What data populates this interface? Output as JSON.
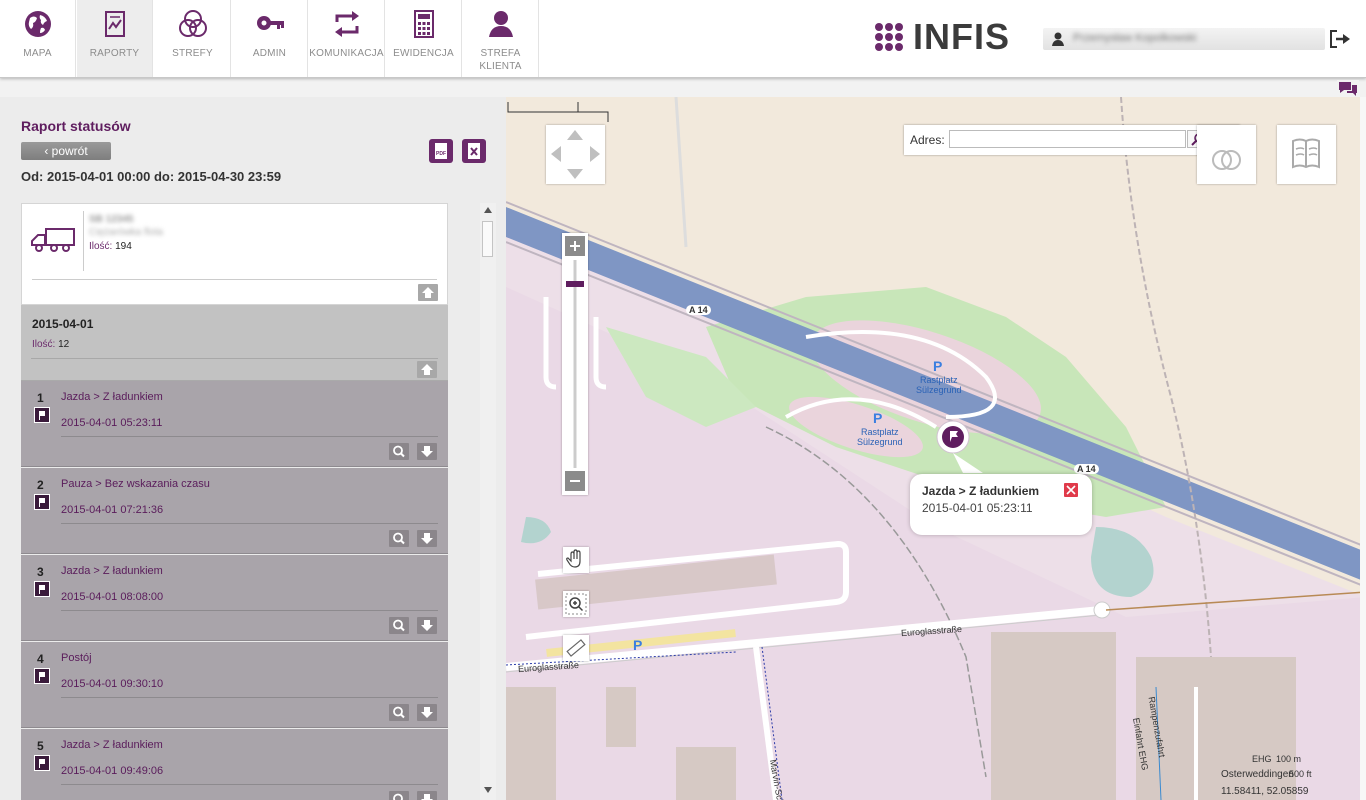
{
  "nav": [
    {
      "label": "MAPA",
      "icon": "globe-icon"
    },
    {
      "label": "RAPORTY",
      "icon": "report-chart-icon",
      "active": true
    },
    {
      "label": "STREFY",
      "icon": "zones-circles-icon"
    },
    {
      "label": "ADMIN",
      "icon": "key-icon"
    },
    {
      "label": "KOMUNIKACJA",
      "icon": "sync-arrows-icon"
    },
    {
      "label": "EWIDENCJA",
      "icon": "calculator-icon"
    },
    {
      "label": "STREFA",
      "label2": "KLIENTA",
      "icon": "user-icon"
    }
  ],
  "brand": {
    "logo_text": "INFIS",
    "accent_color": "#5f1d5f"
  },
  "user": {
    "name": "Przemysław Kopolkowski"
  },
  "report": {
    "title": "Raport statusów",
    "back_label": "‹ powrót",
    "date_range": "Od: 2015-04-01 00:00 do: 2015-04-30 23:59",
    "export_icons": [
      "pdf-export-icon",
      "excel-export-icon"
    ]
  },
  "vehicle": {
    "name": "SB 12345",
    "description": "Ciężarówka flota",
    "qty_label": "Ilość:",
    "qty_value": "194"
  },
  "day": {
    "date": "2015-04-01",
    "qty_label": "Ilość:",
    "qty_value": "12"
  },
  "events": [
    {
      "num": "1",
      "name": "Jazda > Z ładunkiem",
      "time": "2015-04-01 05:23:11"
    },
    {
      "num": "2",
      "name": "Pauza > Bez wskazania czasu",
      "time": "2015-04-01 07:21:36"
    },
    {
      "num": "3",
      "name": "Jazda > Z ładunkiem",
      "time": "2015-04-01 08:08:00"
    },
    {
      "num": "4",
      "name": "Postój",
      "time": "2015-04-01 09:30:10"
    },
    {
      "num": "5",
      "name": "Jazda > Z ładunkiem",
      "time": "2015-04-01 09:49:06"
    }
  ],
  "map": {
    "address_label": "Adres:",
    "address_value": "",
    "popup": {
      "title": "Jazda > Z ładunkiem",
      "time": "2015-04-01 05:23:11"
    },
    "labels": {
      "road1": "A 14",
      "road2": "A 14",
      "rest1": "Rastplatz",
      "rest1b": "Sülzegrund",
      "rest2": "Rastplatz",
      "rest2b": "Sülzegrund",
      "street1": "Euroglasstraße",
      "street2": "Euroglasstraße",
      "street3": "Marvin-Sch",
      "street4": "Rampenzufahrt",
      "street5": "Einfahrt EHG",
      "area": "Osterweddingen",
      "ehg": "EHG",
      "scale_m": "100 m",
      "scale_ft": "500 ft",
      "coords": "11.58411, 52.05859"
    }
  }
}
